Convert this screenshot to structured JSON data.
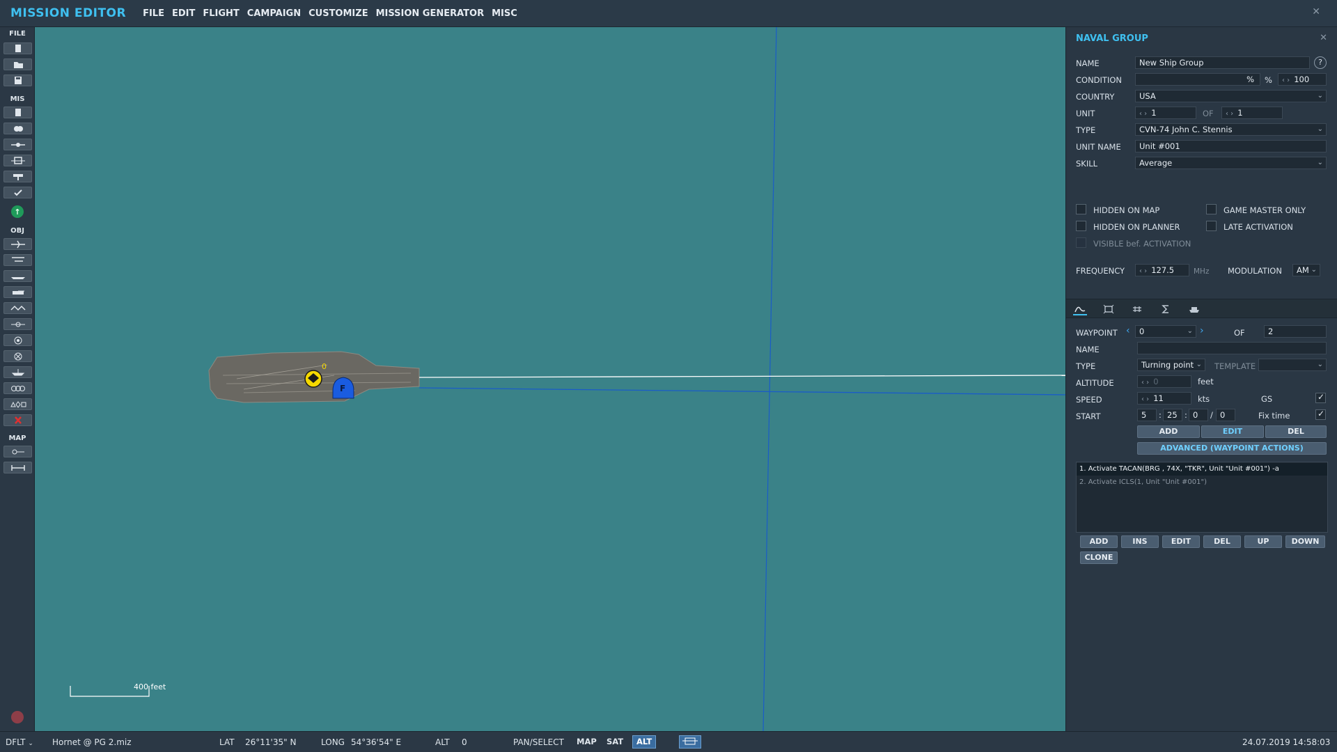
{
  "app": {
    "title": "MISSION EDITOR",
    "close_icon": "close-icon"
  },
  "menu": [
    "FILE",
    "EDIT",
    "FLIGHT",
    "CAMPAIGN",
    "CUSTOMIZE",
    "MISSION GENERATOR",
    "MISC"
  ],
  "toolbar": {
    "sections": {
      "file": "FILE",
      "mis": "MIS",
      "obj": "OBJ",
      "map": "MAP"
    }
  },
  "map": {
    "scale_label": "400 feet",
    "unit_marker_label": "F",
    "waypoint_label": "0",
    "colors": {
      "sea": "#3a8288",
      "route": "#ffffff",
      "blue_line": "#1a5cc8",
      "waypoint": "#f5d800"
    }
  },
  "panel": {
    "title": "NAVAL GROUP",
    "help": "?",
    "name_label": "NAME",
    "name_value": "New Ship Group",
    "condition_label": "CONDITION",
    "condition_pct": "%",
    "condition_pct2": "%",
    "condition_value": "100",
    "country_label": "COUNTRY",
    "country_value": "USA",
    "unit_label": "UNIT",
    "unit_value": "1",
    "unit_of": "OF",
    "unit_total": "1",
    "type_label": "TYPE",
    "type_value": "CVN-74 John C. Stennis",
    "unit_name_label": "UNIT NAME",
    "unit_name_value": "Unit #001",
    "skill_label": "SKILL",
    "skill_value": "Average",
    "hidden_on_map": "HIDDEN ON MAP",
    "game_master_only": "GAME MASTER ONLY",
    "hidden_on_planner": "HIDDEN ON PLANNER",
    "late_activation": "LATE ACTIVATION",
    "visible_bef_activation": "VISIBLE bef. ACTIVATION",
    "frequency_label": "FREQUENCY",
    "frequency_value": "127.5",
    "frequency_unit": "MHz",
    "modulation_label": "MODULATION",
    "modulation_value": "AM",
    "waypoint_label": "WAYPOINT",
    "waypoint_value": "0",
    "waypoint_of": "OF",
    "waypoint_total": "2",
    "wp_name_label": "NAME",
    "wp_name_value": "",
    "wp_type_label": "TYPE",
    "wp_type_value": "Turning point",
    "template_label": "TEMPLATE",
    "altitude_label": "ALTITUDE",
    "altitude_value": "0",
    "altitude_unit": "feet",
    "speed_label": "SPEED",
    "speed_value": "11",
    "speed_unit": "kts",
    "gs_label": "GS",
    "start_label": "START",
    "start_h": "5",
    "start_m": "25",
    "start_s": "0",
    "start_d": "0",
    "start_sep1": ":",
    "start_sep2": ":",
    "start_sep3": "/",
    "fix_time_label": "Fix time",
    "btn_add": "ADD",
    "btn_edit": "EDIT",
    "btn_del": "DEL",
    "btn_advanced": "ADVANCED (WAYPOINT ACTIONS)",
    "actions": [
      "1. Activate TACAN(BRG , 74X, \"TKR\", Unit \"Unit #001\")   -a",
      "2. Activate ICLS(1, Unit \"Unit #001\")"
    ],
    "actions_buttons": [
      "ADD",
      "INS",
      "EDIT",
      "DEL",
      "UP",
      "DOWN"
    ],
    "clone": "CLONE"
  },
  "status": {
    "profile": "DFLT",
    "file": "Hornet @ PG 2.miz",
    "lat_label": "LAT",
    "lat_value": "26°11'35\" N",
    "long_label": "LONG",
    "long_value": "54°36'54\" E",
    "alt_label": "ALT",
    "alt_value": "0",
    "pan_select": "PAN/SELECT",
    "btn_map": "MAP",
    "btn_sat": "SAT",
    "btn_alt": "ALT",
    "datetime": "24.07.2019 14:58:03"
  }
}
